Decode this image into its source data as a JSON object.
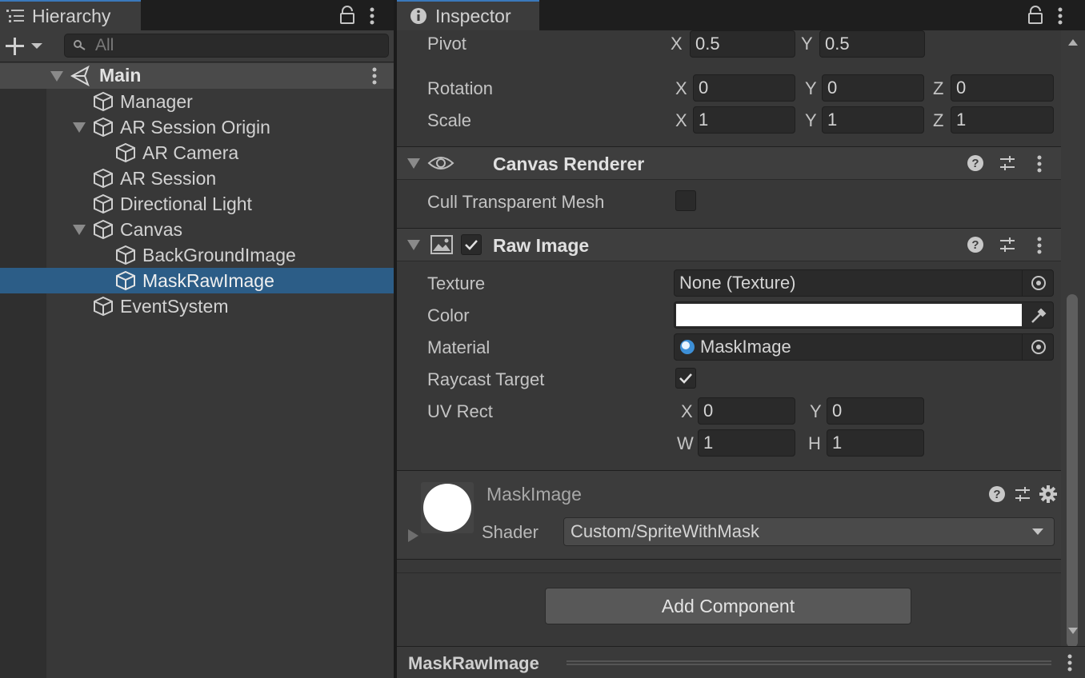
{
  "hierarchy": {
    "tab_label": "Hierarchy",
    "search_placeholder": "All",
    "scene": "Main",
    "items": [
      {
        "label": "Manager"
      },
      {
        "label": "AR Session Origin"
      },
      {
        "label": "AR Camera"
      },
      {
        "label": "AR Session"
      },
      {
        "label": "Directional Light"
      },
      {
        "label": "Canvas"
      },
      {
        "label": "BackGroundImage"
      },
      {
        "label": "MaskRawImage"
      },
      {
        "label": "EventSystem"
      }
    ]
  },
  "inspector": {
    "tab_label": "Inspector",
    "transform": {
      "pivot_label": "Pivot",
      "pivot_x": "0.5",
      "pivot_y": "0.5",
      "rotation_label": "Rotation",
      "rotation_x": "0",
      "rotation_y": "0",
      "rotation_z": "0",
      "scale_label": "Scale",
      "scale_x": "1",
      "scale_y": "1",
      "scale_z": "1",
      "axis_x": "X",
      "axis_y": "Y",
      "axis_z": "Z",
      "axis_w": "W",
      "axis_h": "H"
    },
    "canvas_renderer": {
      "title": "Canvas Renderer",
      "cull_label": "Cull Transparent Mesh",
      "cull_checked": false
    },
    "raw_image": {
      "title": "Raw Image",
      "enabled": true,
      "texture_label": "Texture",
      "texture_value": "None (Texture)",
      "color_label": "Color",
      "color_value": "#ffffff",
      "material_label": "Material",
      "material_value": "MaskImage",
      "raycast_label": "Raycast Target",
      "raycast_checked": true,
      "uvrect_label": "UV Rect",
      "uv_x": "0",
      "uv_y": "0",
      "uv_w": "1",
      "uv_h": "1"
    },
    "material_preview": {
      "name": "MaskImage",
      "shader_label": "Shader",
      "shader_value": "Custom/SpriteWithMask"
    },
    "add_component_label": "Add Component",
    "footer_title": "MaskRawImage"
  },
  "colors": {
    "selection": "#2c5d87",
    "accent_tab": "#3a79bb"
  }
}
